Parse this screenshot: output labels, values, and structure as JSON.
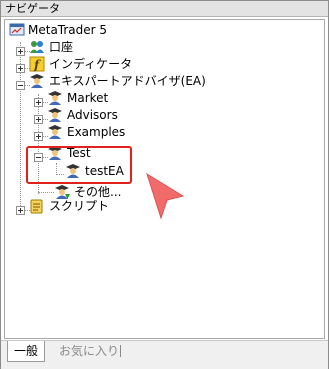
{
  "window": {
    "title": "ナビゲータ"
  },
  "tree": {
    "root": "MetaTrader 5",
    "account": "口座",
    "indicators": "インディケータ",
    "expert_advisors": "エキスパートアドバイザ(EA)",
    "market": "Market",
    "advisors": "Advisors",
    "examples": "Examples",
    "test": "Test",
    "test_ea": "testEA",
    "other": "その他...",
    "scripts": "スクリプト"
  },
  "tabs": [
    {
      "label": "一般"
    },
    {
      "label": "お気に入り"
    }
  ],
  "colors": {
    "highlight": "#e0221c",
    "arrow": "#f26b6b"
  }
}
